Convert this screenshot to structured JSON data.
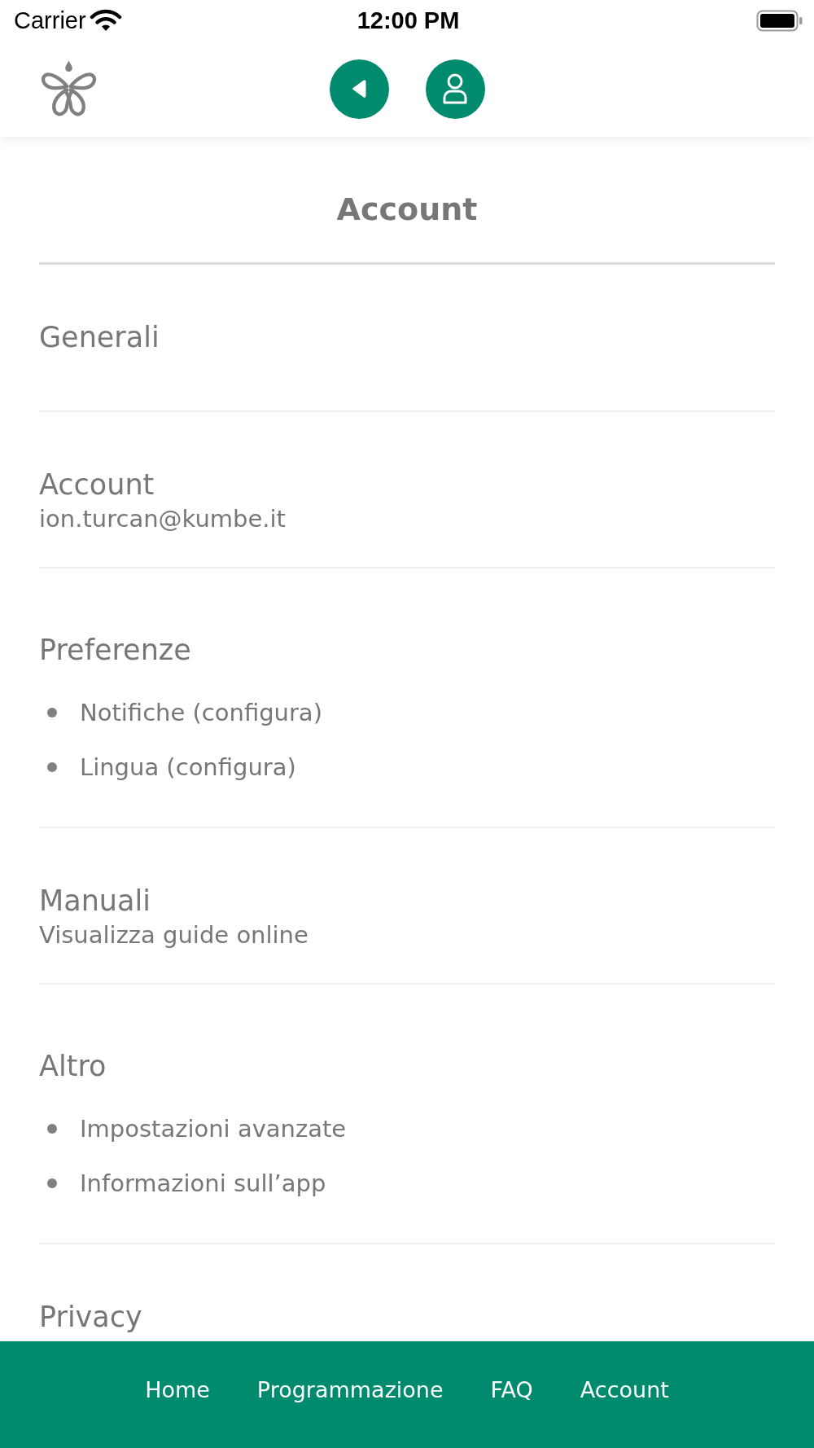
{
  "status_bar": {
    "carrier": "Carrier",
    "time": "12:00 PM"
  },
  "page_title": "Account",
  "sections": [
    {
      "kind": "plain",
      "title": "Generali"
    },
    {
      "kind": "detail",
      "title": "Account",
      "subtitle": "ion.turcan@kumbe.it"
    },
    {
      "kind": "list",
      "title": "Preferenze",
      "items": [
        "Notifiche (configura)",
        "Lingua (configura)"
      ]
    },
    {
      "kind": "detail",
      "title": "Manuali",
      "subtitle": "Visualizza guide online"
    },
    {
      "kind": "list",
      "title": "Altro",
      "items": [
        "Impostazioni avanzate",
        "Informazioni sull’app"
      ]
    },
    {
      "kind": "plain",
      "title": "Privacy"
    }
  ],
  "bottom_nav": [
    "Home",
    "Programmazione",
    "FAQ",
    "Account"
  ]
}
